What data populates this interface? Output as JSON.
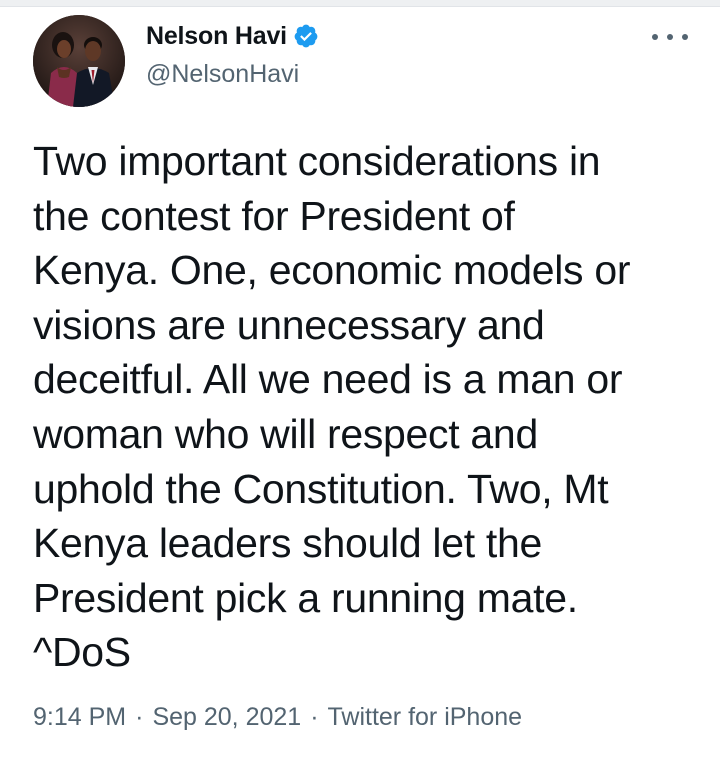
{
  "author": {
    "display_name": "Nelson Havi",
    "handle": "@NelsonHavi",
    "verified": true,
    "avatar_icon": "profile-photo-couple"
  },
  "tweet": {
    "text": "Two important considerations in\nthe contest for President of\nKenya. One, economic models or\nvisions are unnecessary and\ndeceitful. All we need is a man or\nwoman who will respect and\nuphold the Constitution. Two, Mt\nKenya leaders should let the\nPresident pick a running mate.\n^DoS",
    "time": "9:14 PM",
    "date": "Sep 20, 2021",
    "source": "Twitter for iPhone",
    "separator": "·"
  },
  "colors": {
    "verified_badge": "#1d9bf0",
    "text_primary": "#0f1419",
    "text_secondary": "#536471"
  },
  "icons": {
    "more": "more-horizontal-icon",
    "verified": "verified-badge-icon"
  }
}
